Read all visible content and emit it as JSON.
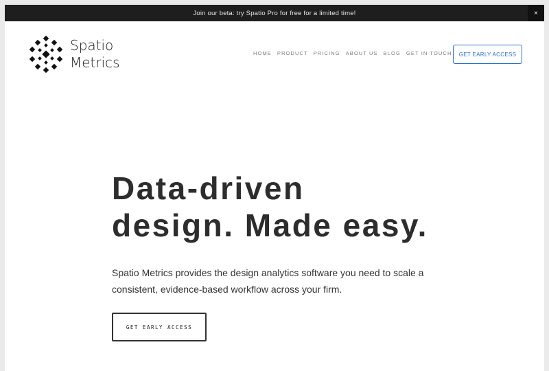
{
  "announcement": {
    "text": "Join our beta: try Spatio Pro for free for a limited time!",
    "close_label": "×"
  },
  "brand": {
    "line1": "Spatio",
    "line2": "Metrics",
    "logo_icon": "hexagon-cube-lattice-icon"
  },
  "nav": {
    "items": [
      {
        "label": "HOME"
      },
      {
        "label": "PRODUCT"
      },
      {
        "label": "PRICING"
      },
      {
        "label": "ABOUT US"
      },
      {
        "label": "BLOG"
      },
      {
        "label": "GET IN TOUCH"
      }
    ],
    "cta_label": "GET EARLY ACCESS"
  },
  "hero": {
    "title_line1": "Data-driven",
    "title_line2": "design. Made easy.",
    "subtitle": "Spatio Metrics provides the design analytics software you need to scale a consistent, evidence-based workflow across your firm.",
    "cta_label": "GET EARLY ACCESS"
  },
  "colors": {
    "announcement_bg": "#1e1e1e",
    "accent": "#2a6fcf",
    "heading": "#2d2d2d"
  }
}
